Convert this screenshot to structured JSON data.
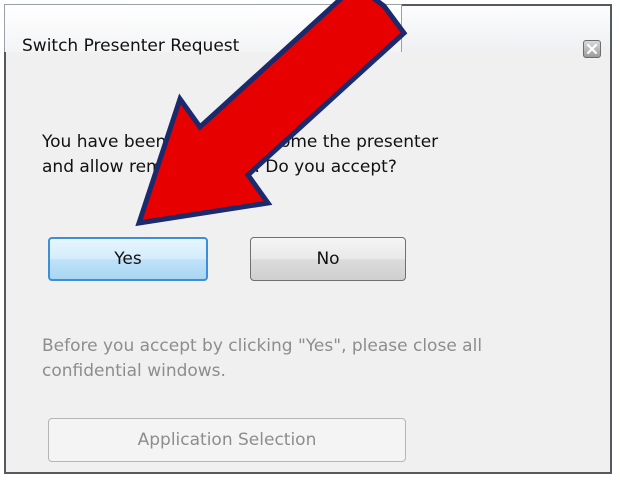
{
  "window": {
    "title": "Switch Presenter Request",
    "close_icon": "close-icon"
  },
  "message": {
    "text": "You have been asked to become the presenter\nand allow remote control. Do you accept?"
  },
  "buttons": {
    "yes_label": "Yes",
    "no_label": "No",
    "application_selection_label": "Application Selection"
  },
  "note": {
    "text": "Before you accept by clicking \"Yes\", please close all\nconfidential windows."
  },
  "annotation": {
    "icon": "red-arrow-icon",
    "color": "#e60000",
    "outline_color": "#1a2a6c"
  }
}
